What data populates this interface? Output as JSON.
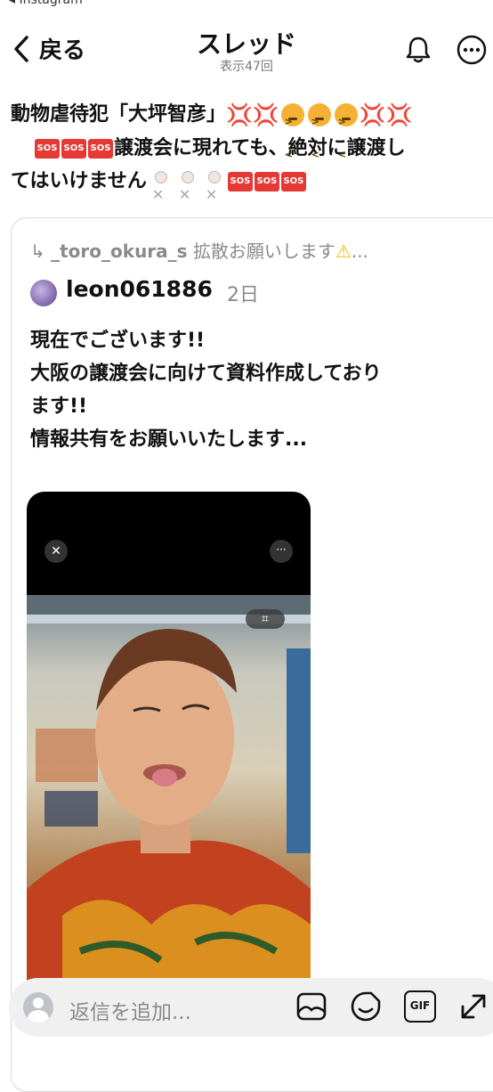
{
  "status": {
    "back_app": "◂ Instagram"
  },
  "header": {
    "back_label": "戻る",
    "title": "スレッド",
    "views": "表示47回"
  },
  "post": {
    "line1_text": "動物虐待犯「大坪智彦」",
    "line2_text": "譲渡会に現れても、絶対に譲渡し",
    "line3_text": "てはいけません",
    "sos_label": "SOS"
  },
  "quoted": {
    "repost_user": "_toro_okura_s",
    "repost_text": "拡散お願いします",
    "repost_ellipsis": "...",
    "username": "leon061886",
    "age": "2日",
    "body_lines": [
      "現在でございます!!",
      "大阪の譲渡会に向けて資料作成しており",
      "ます!!",
      "情報共有をお願いいたします..."
    ]
  },
  "reply": {
    "placeholder": "返信を追加...",
    "gif_label": "GIF"
  },
  "icons": {
    "back": "chevron-left-icon",
    "bell": "bell-icon",
    "more": "more-icon",
    "repost": "repost-arrow-icon",
    "warning": "warning-icon",
    "image": "image-icon",
    "sticker": "sticker-icon",
    "gif": "gif-icon",
    "expand": "expand-icon"
  },
  "colors": {
    "sos": "#e53935",
    "anger": "#e53935",
    "muted": "#8a8a8a",
    "reply_bg": "#f0f0f0"
  }
}
